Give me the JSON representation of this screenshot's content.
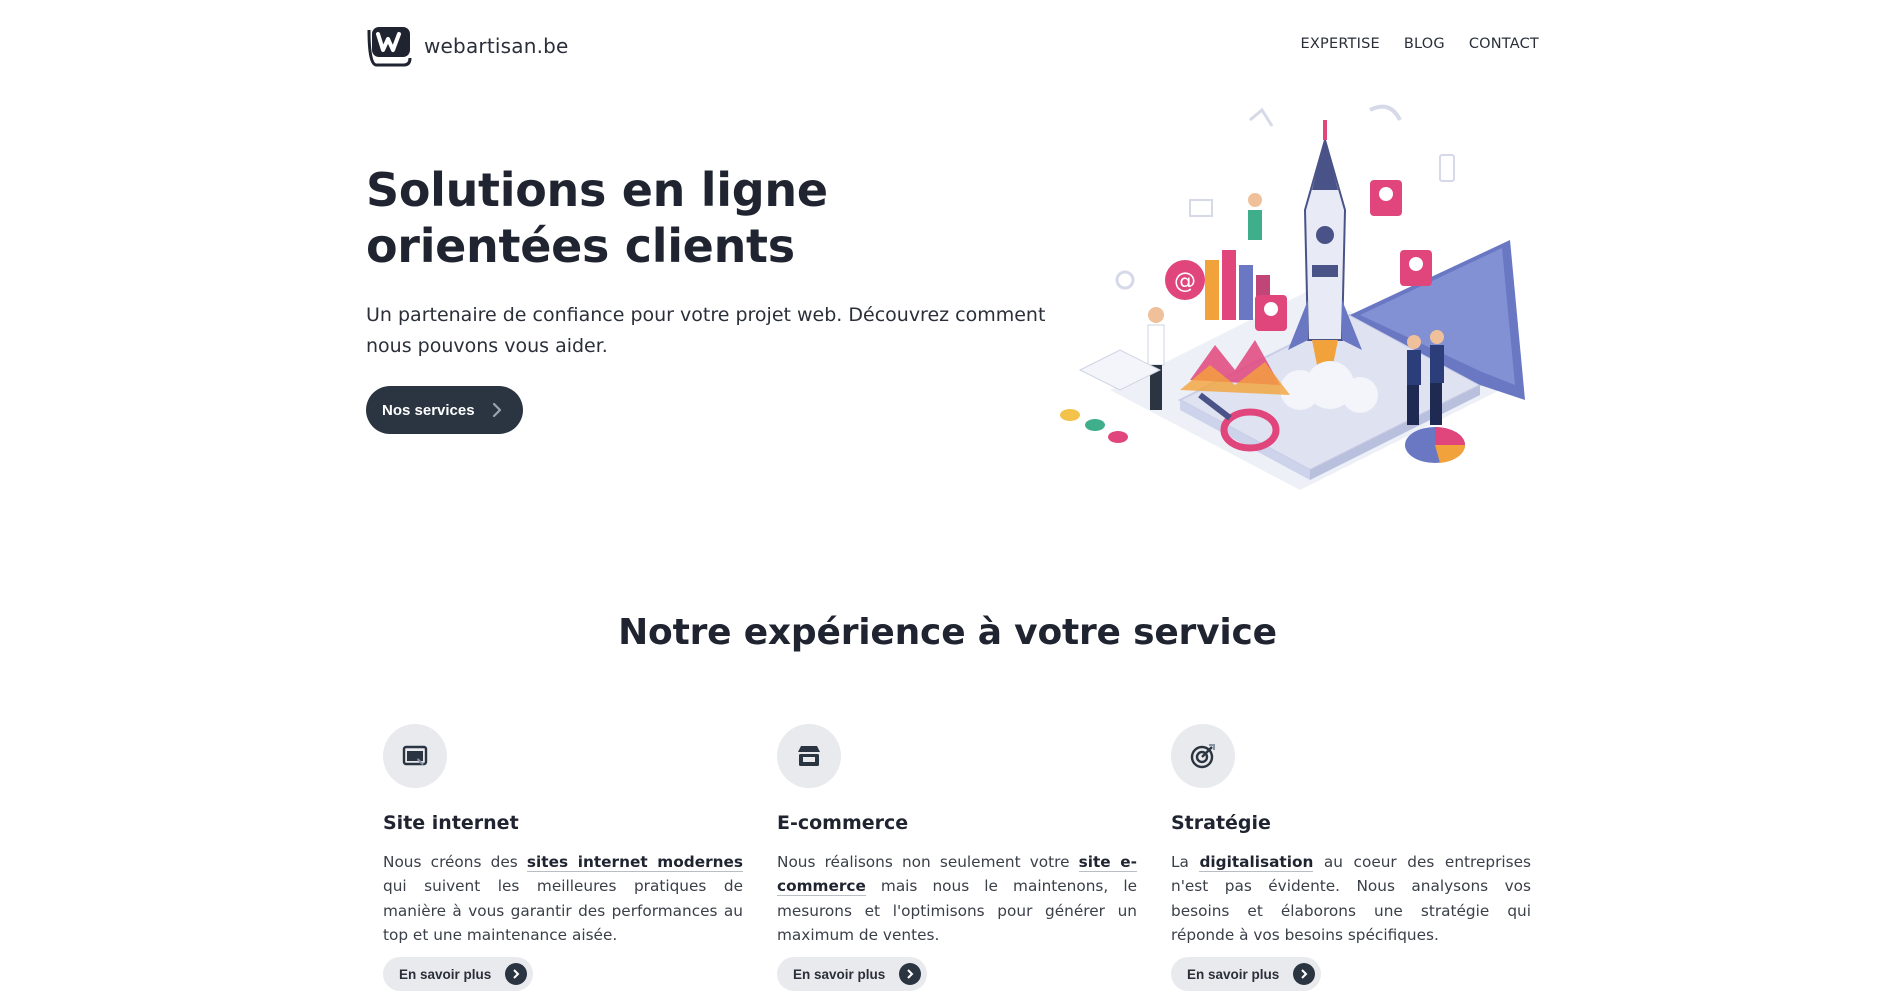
{
  "brand": {
    "name": "webartisan.be",
    "logo_icon": "w-logo-icon"
  },
  "nav": [
    {
      "label": "EXPERTISE"
    },
    {
      "label": "BLOG"
    },
    {
      "label": "CONTACT"
    }
  ],
  "hero": {
    "title": "Solutions en ligne orientées clients",
    "subtitle": "Un partenaire de confiance pour votre projet web. Découvrez comment nous pouvons vous aider.",
    "button": "Nos services",
    "button_icon": "chevron-right-icon",
    "illustration": "isometric-rocket-laptop-illustration"
  },
  "section": {
    "title": "Notre expérience à votre service",
    "cards": [
      {
        "icon": "website-icon",
        "title": "Site internet",
        "text_parts": [
          "Nous créons des ",
          "sites internet modernes",
          " qui suivent les meilleures pratiques de manière à vous garantir des performances au top et une maintenance aisée."
        ],
        "button": "En savoir plus"
      },
      {
        "icon": "store-icon",
        "title": "E-commerce",
        "text_parts": [
          "Nous réalisons non seulement votre ",
          "site e-commerce",
          " mais nous le maintenons, le mesurons et l'optimisons pour générer un maximum de ventes."
        ],
        "button": "En savoir plus"
      },
      {
        "icon": "target-icon",
        "title": "Stratégie",
        "text_parts": [
          "La ",
          "digitalisation",
          " au coeur des entreprises n'est pas évidente. Nous analysons vos besoins et élaborons une stratégie qui réponde à vos besoins spécifiques."
        ],
        "button": "En savoir plus"
      }
    ]
  },
  "colors": {
    "primary": "#2b3542",
    "muted_bg": "#e9eaed",
    "accent_pink": "#e0457b",
    "accent_blue": "#6a78c4"
  }
}
